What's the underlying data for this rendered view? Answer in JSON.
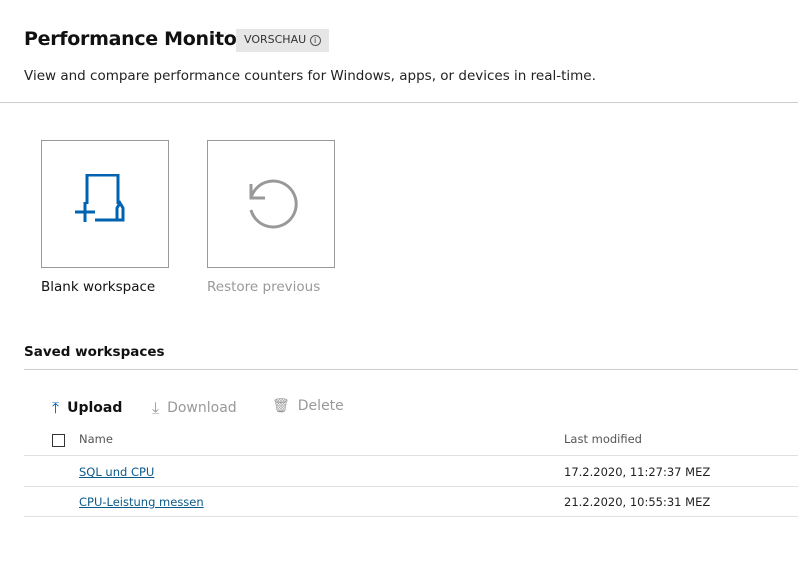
{
  "header": {
    "title": "Performance Monitor",
    "badge": "VORSCHAU",
    "badge_icon": "info-icon",
    "description": "View and compare performance counters for Windows, apps, or devices in real-time."
  },
  "tiles": [
    {
      "label": "Blank workspace",
      "icon": "new-workspace-icon",
      "color": "#0063b1"
    },
    {
      "label": "Restore previous",
      "icon": "restore-icon",
      "color": "#999999"
    }
  ],
  "saved": {
    "title": "Saved workspaces",
    "toolbar": {
      "upload": "Upload",
      "download": "Download",
      "delete": "Delete"
    },
    "columns": {
      "name": "Name",
      "modified": "Last modified"
    },
    "rows": [
      {
        "name": "SQL und CPU",
        "modified": "17.2.2020, 11:27:37 MEZ"
      },
      {
        "name": "CPU-Leistung messen",
        "modified": "21.2.2020, 10:55:31 MEZ"
      }
    ]
  }
}
